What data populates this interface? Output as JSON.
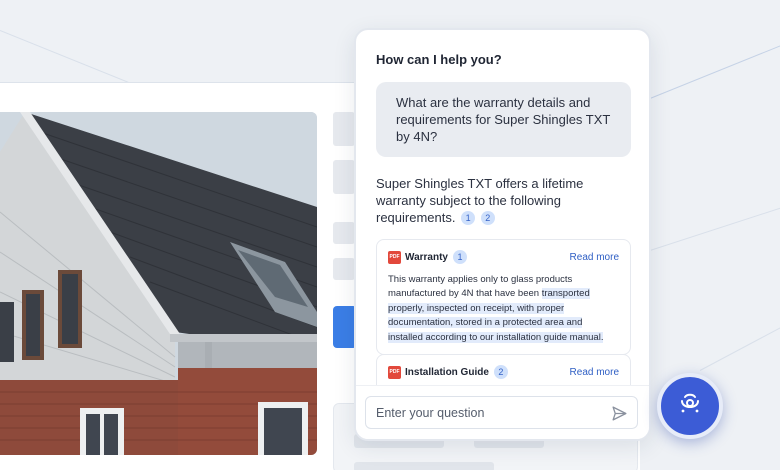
{
  "chat": {
    "title": "How can I help you?",
    "user_question": "What are the warranty details and requirements for Super Shingles TXT by 4N?",
    "answer_text": "Super Shingles TXT offers a lifetime warranty subject to the following requirements.",
    "answer_citations": [
      "1",
      "2"
    ],
    "sources": [
      {
        "type_icon": "pdf-icon",
        "title": "Warranty",
        "citation": "1",
        "read_more": "Read more",
        "body_plain": "This warranty applies only to glass products manufactured by 4N that have been ",
        "body_highlight": "transported properly, inspected on receipt, with proper documentation, stored in a protected area and installed according to our installation guide manual."
      },
      {
        "type_icon": "pdf-icon",
        "title": "Installation Guide",
        "citation": "2",
        "read_more": "Read more"
      }
    ],
    "input_placeholder": "Enter your question",
    "send_icon": "send-icon"
  },
  "fab": {
    "icon": "assistant-icon"
  },
  "pdf_badge": "PDF",
  "colors": {
    "accent": "#3c5cd6",
    "link": "#2f5fc4",
    "citation_bg": "#cfe0fb",
    "highlight": "#e2ebfb",
    "pdf_red": "#e2483b"
  }
}
